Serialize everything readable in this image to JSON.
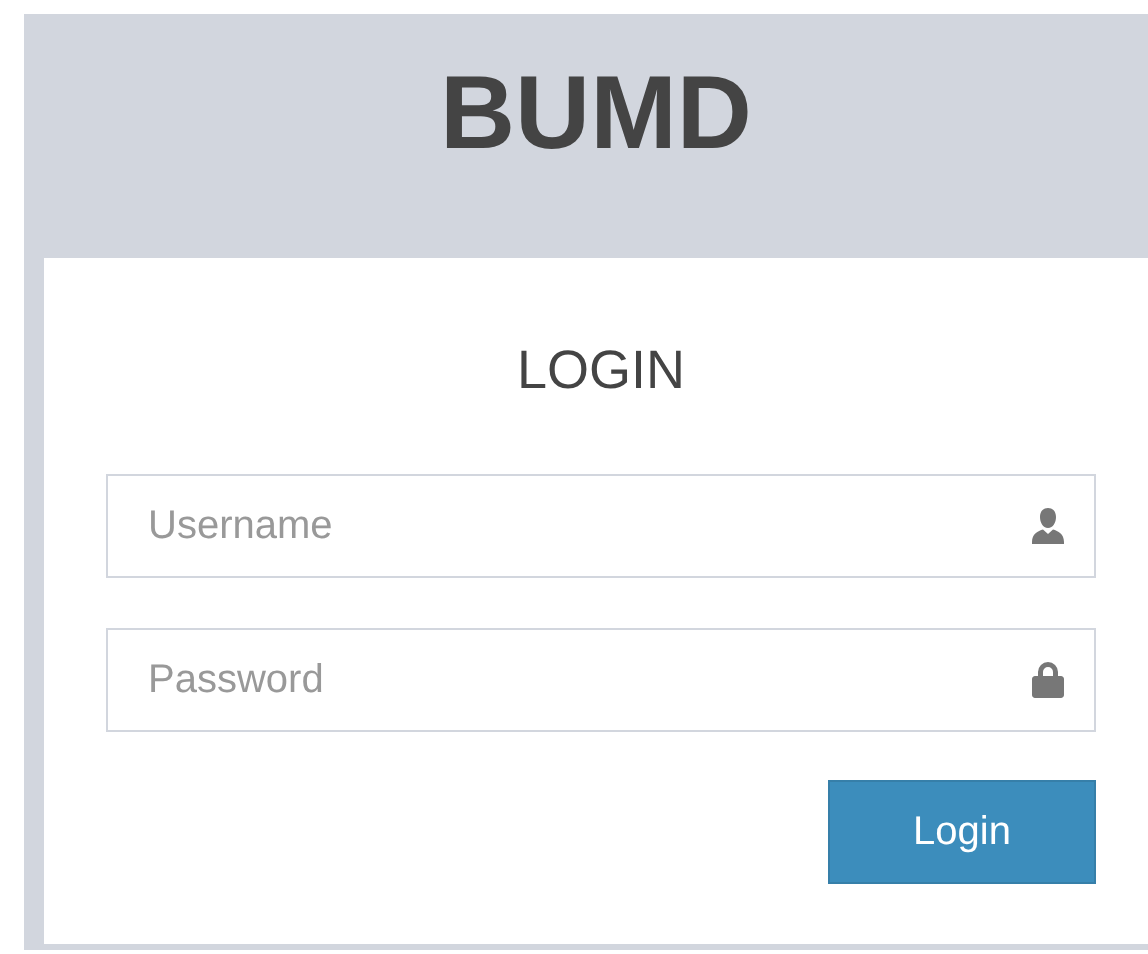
{
  "brand": "BUMD",
  "login_box": {
    "title": "LOGIN",
    "fields": [
      {
        "kind": "username",
        "placeholder": "Username"
      },
      {
        "kind": "password",
        "placeholder": "Password"
      }
    ],
    "submit_button": "Login"
  }
}
